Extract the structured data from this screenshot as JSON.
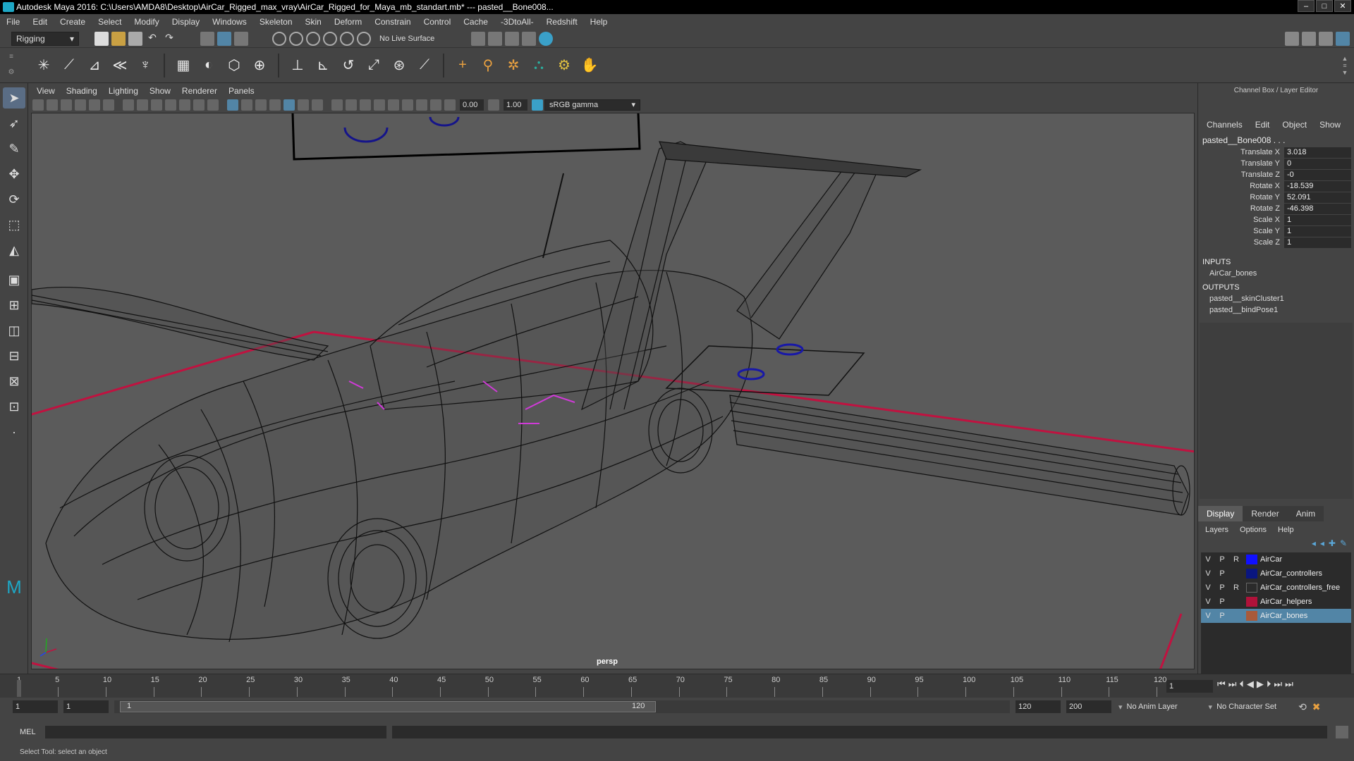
{
  "window": {
    "title": "Autodesk Maya 2016: C:\\Users\\AMDA8\\Desktop\\AirCar_Rigged_max_vray\\AirCar_Rigged_for_Maya_mb_standart.mb*   ---   pasted__Bone008...",
    "controls": [
      "–",
      "□",
      "✕"
    ]
  },
  "menubar": [
    "File",
    "Edit",
    "Create",
    "Select",
    "Modify",
    "Display",
    "Windows",
    "Skeleton",
    "Skin",
    "Deform",
    "Constrain",
    "Control",
    "Cache",
    "-3DtoAll-",
    "Redshift",
    "Help"
  ],
  "statusline": {
    "menuset": "Rigging",
    "live_surface": "No Live Surface"
  },
  "viewport": {
    "menu": [
      "View",
      "Shading",
      "Lighting",
      "Show",
      "Renderer",
      "Panels"
    ],
    "exposure": "0.00",
    "gamma": "1.00",
    "colorspace": "sRGB gamma",
    "camera_label": "persp"
  },
  "channel_box": {
    "title": "Channel Box / Layer Editor",
    "tabs": [
      "Channels",
      "Edit",
      "Object",
      "Show"
    ],
    "object": "pasted__Bone008 . . .",
    "attributes": [
      {
        "name": "Translate X",
        "value": "3.018"
      },
      {
        "name": "Translate Y",
        "value": "0"
      },
      {
        "name": "Translate Z",
        "value": "-0"
      },
      {
        "name": "Rotate X",
        "value": "-18.539"
      },
      {
        "name": "Rotate Y",
        "value": "52.091"
      },
      {
        "name": "Rotate Z",
        "value": "-46.398"
      },
      {
        "name": "Scale X",
        "value": "1"
      },
      {
        "name": "Scale Y",
        "value": "1"
      },
      {
        "name": "Scale Z",
        "value": "1"
      }
    ],
    "inputs_label": "INPUTS",
    "inputs": [
      "AirCar_bones"
    ],
    "outputs_label": "OUTPUTS",
    "outputs": [
      "pasted__skinCluster1",
      "pasted__bindPose1"
    ]
  },
  "layer_editor": {
    "tabs": [
      "Display",
      "Render",
      "Anim"
    ],
    "menu": [
      "Layers",
      "Options",
      "Help"
    ],
    "layers": [
      {
        "v": "V",
        "p": "P",
        "r": "R",
        "color": "#1010ff",
        "name": "AirCar"
      },
      {
        "v": "V",
        "p": "P",
        "r": "",
        "color": "#0a1680",
        "name": "AirCar_controllers"
      },
      {
        "v": "V",
        "p": "P",
        "r": "R",
        "color": "#2b2b2b",
        "name": "AirCar_controllers_free"
      },
      {
        "v": "V",
        "p": "P",
        "r": "",
        "color": "#b0123a",
        "name": "AirCar_helpers"
      },
      {
        "v": "V",
        "p": "P",
        "r": "",
        "color": "#a85a3a",
        "name": "AirCar_bones"
      }
    ]
  },
  "timeline": {
    "ticks": [
      "1",
      "5",
      "10",
      "15",
      "20",
      "25",
      "30",
      "35",
      "40",
      "45",
      "50",
      "55",
      "60",
      "65",
      "70",
      "75",
      "80",
      "85",
      "90",
      "95",
      "100",
      "105",
      "110",
      "115",
      "120"
    ],
    "current_frame": "1"
  },
  "range": {
    "start": "1",
    "playback_start": "1",
    "slider_start": "1",
    "slider_end": "120",
    "playback_end": "120",
    "end": "200",
    "anim_layer": "No Anim Layer",
    "character_set": "No Character Set"
  },
  "command_line": {
    "label": "MEL"
  },
  "help_line": "Select Tool: select an object"
}
